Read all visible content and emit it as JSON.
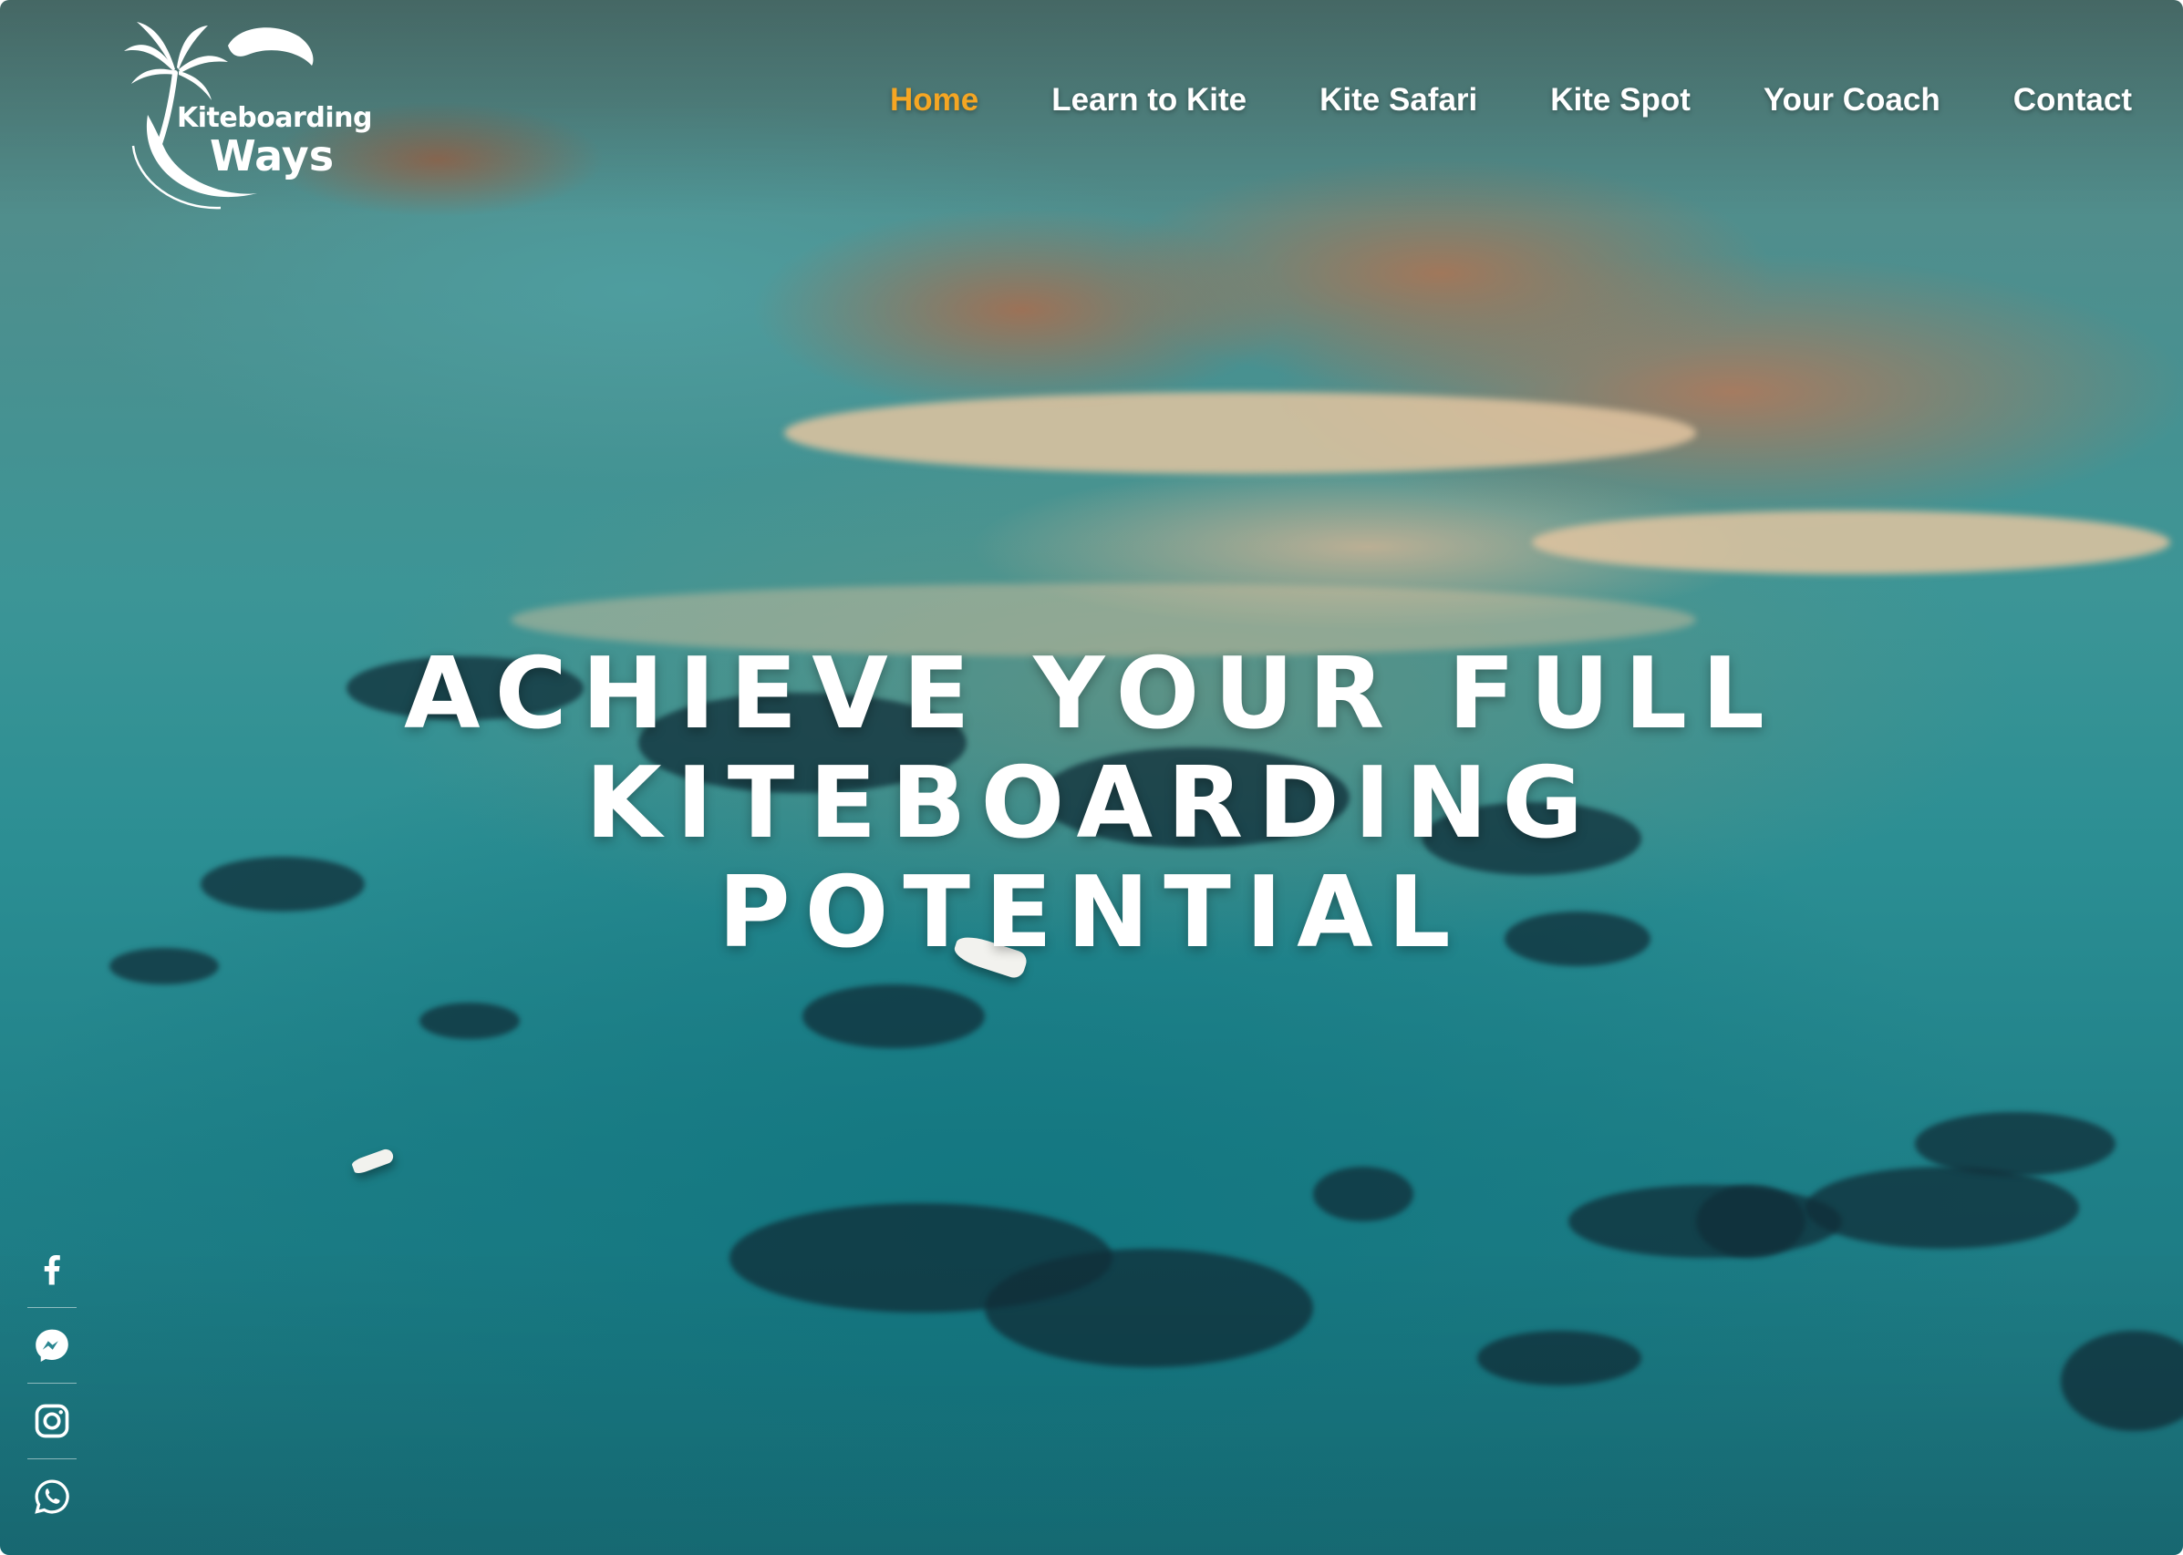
{
  "brand": {
    "line1": "Kiteboarding",
    "line2": "Ways"
  },
  "nav": {
    "items": [
      {
        "label": "Home",
        "active": true
      },
      {
        "label": "Learn to Kite",
        "active": false
      },
      {
        "label": "Kite Safari",
        "active": false
      },
      {
        "label": "Kite Spot",
        "active": false
      },
      {
        "label": "Your Coach",
        "active": false
      },
      {
        "label": "Contact",
        "active": false
      }
    ],
    "active_color": "#f5a623",
    "text_color": "#ffffff"
  },
  "hero": {
    "headline_lines": [
      "ACHIEVE YOUR FULL",
      "KITEBOARDING",
      "POTENTIAL"
    ]
  },
  "social": {
    "icons": [
      "facebook-icon",
      "messenger-icon",
      "instagram-icon",
      "whatsapp-icon"
    ]
  }
}
